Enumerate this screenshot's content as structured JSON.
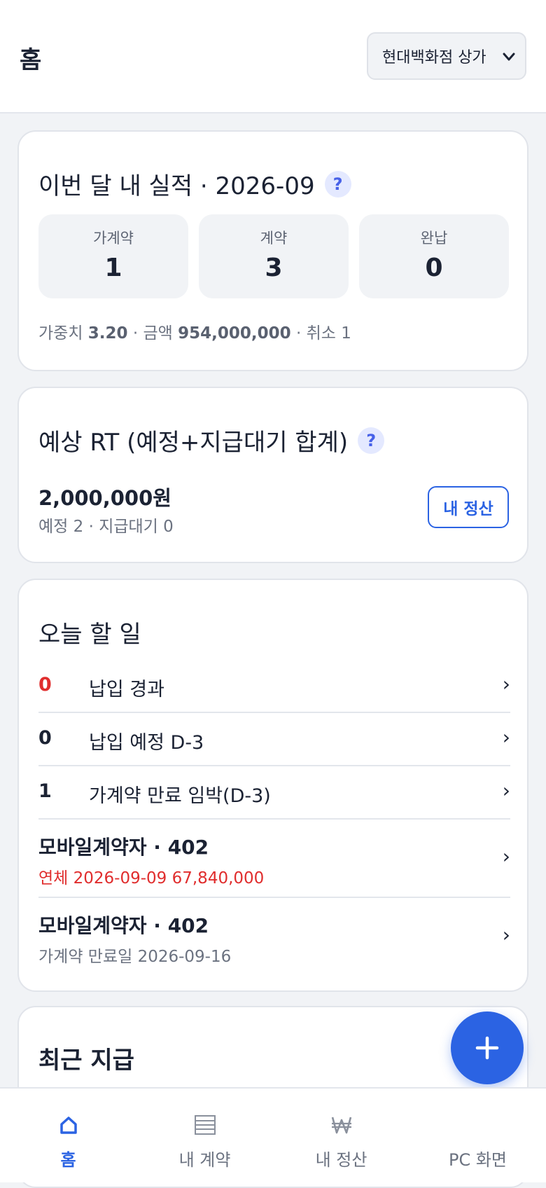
{
  "header": {
    "title": "홈",
    "store_select": {
      "value": "현대백화점 상가"
    }
  },
  "performance": {
    "title": "이번 달 내 실적 · 2026-09",
    "help": "?",
    "stats": [
      {
        "label": "가계약",
        "value": "1"
      },
      {
        "label": "계약",
        "value": "3"
      },
      {
        "label": "완납",
        "value": "0"
      }
    ],
    "summary": {
      "weight_label": "가중치",
      "weight_value": "3.20",
      "sep1": "·",
      "amount_label": "금액",
      "amount_value": "954,000,000",
      "sep2": "·",
      "cancel": "취소 1"
    }
  },
  "rt": {
    "title": "예상 RT (예정+지급대기 합계)",
    "help": "?",
    "amount": "2,000,000원",
    "sub": "예정 2 · 지급대기 0",
    "button": "내 정산"
  },
  "todo": {
    "title": "오늘 할 일",
    "rows": [
      {
        "count": "0",
        "text": "납입 경과"
      },
      {
        "count": "0",
        "text": "납입 예정 D-3"
      },
      {
        "count": "1",
        "text": "가계약 만료 임박(D-3)"
      }
    ],
    "items": [
      {
        "name": "모바일계약자 · 402",
        "detail": "연체 2026-09-09 67,840,000"
      },
      {
        "name": "모바일계약자 · 402",
        "detail": "가계약 만료일 2026-09-16"
      }
    ],
    "chevron": "›"
  },
  "recent": {
    "title": "최근 지급"
  },
  "fab": {
    "icon": "plus-icon"
  },
  "nav": [
    {
      "label": "홈",
      "icon": "home-icon",
      "active": true
    },
    {
      "label": "내 계약",
      "icon": "list-icon",
      "active": false
    },
    {
      "label": "내 정산",
      "icon": "won-icon",
      "active": false
    },
    {
      "label": "PC 화면",
      "icon": "desktop-icon",
      "active": false
    }
  ],
  "colors": {
    "accent": "#2b63e3",
    "danger": "#e02d2d",
    "background": "#f1f3f6",
    "help_badge_bg": "#e4e9ff"
  }
}
